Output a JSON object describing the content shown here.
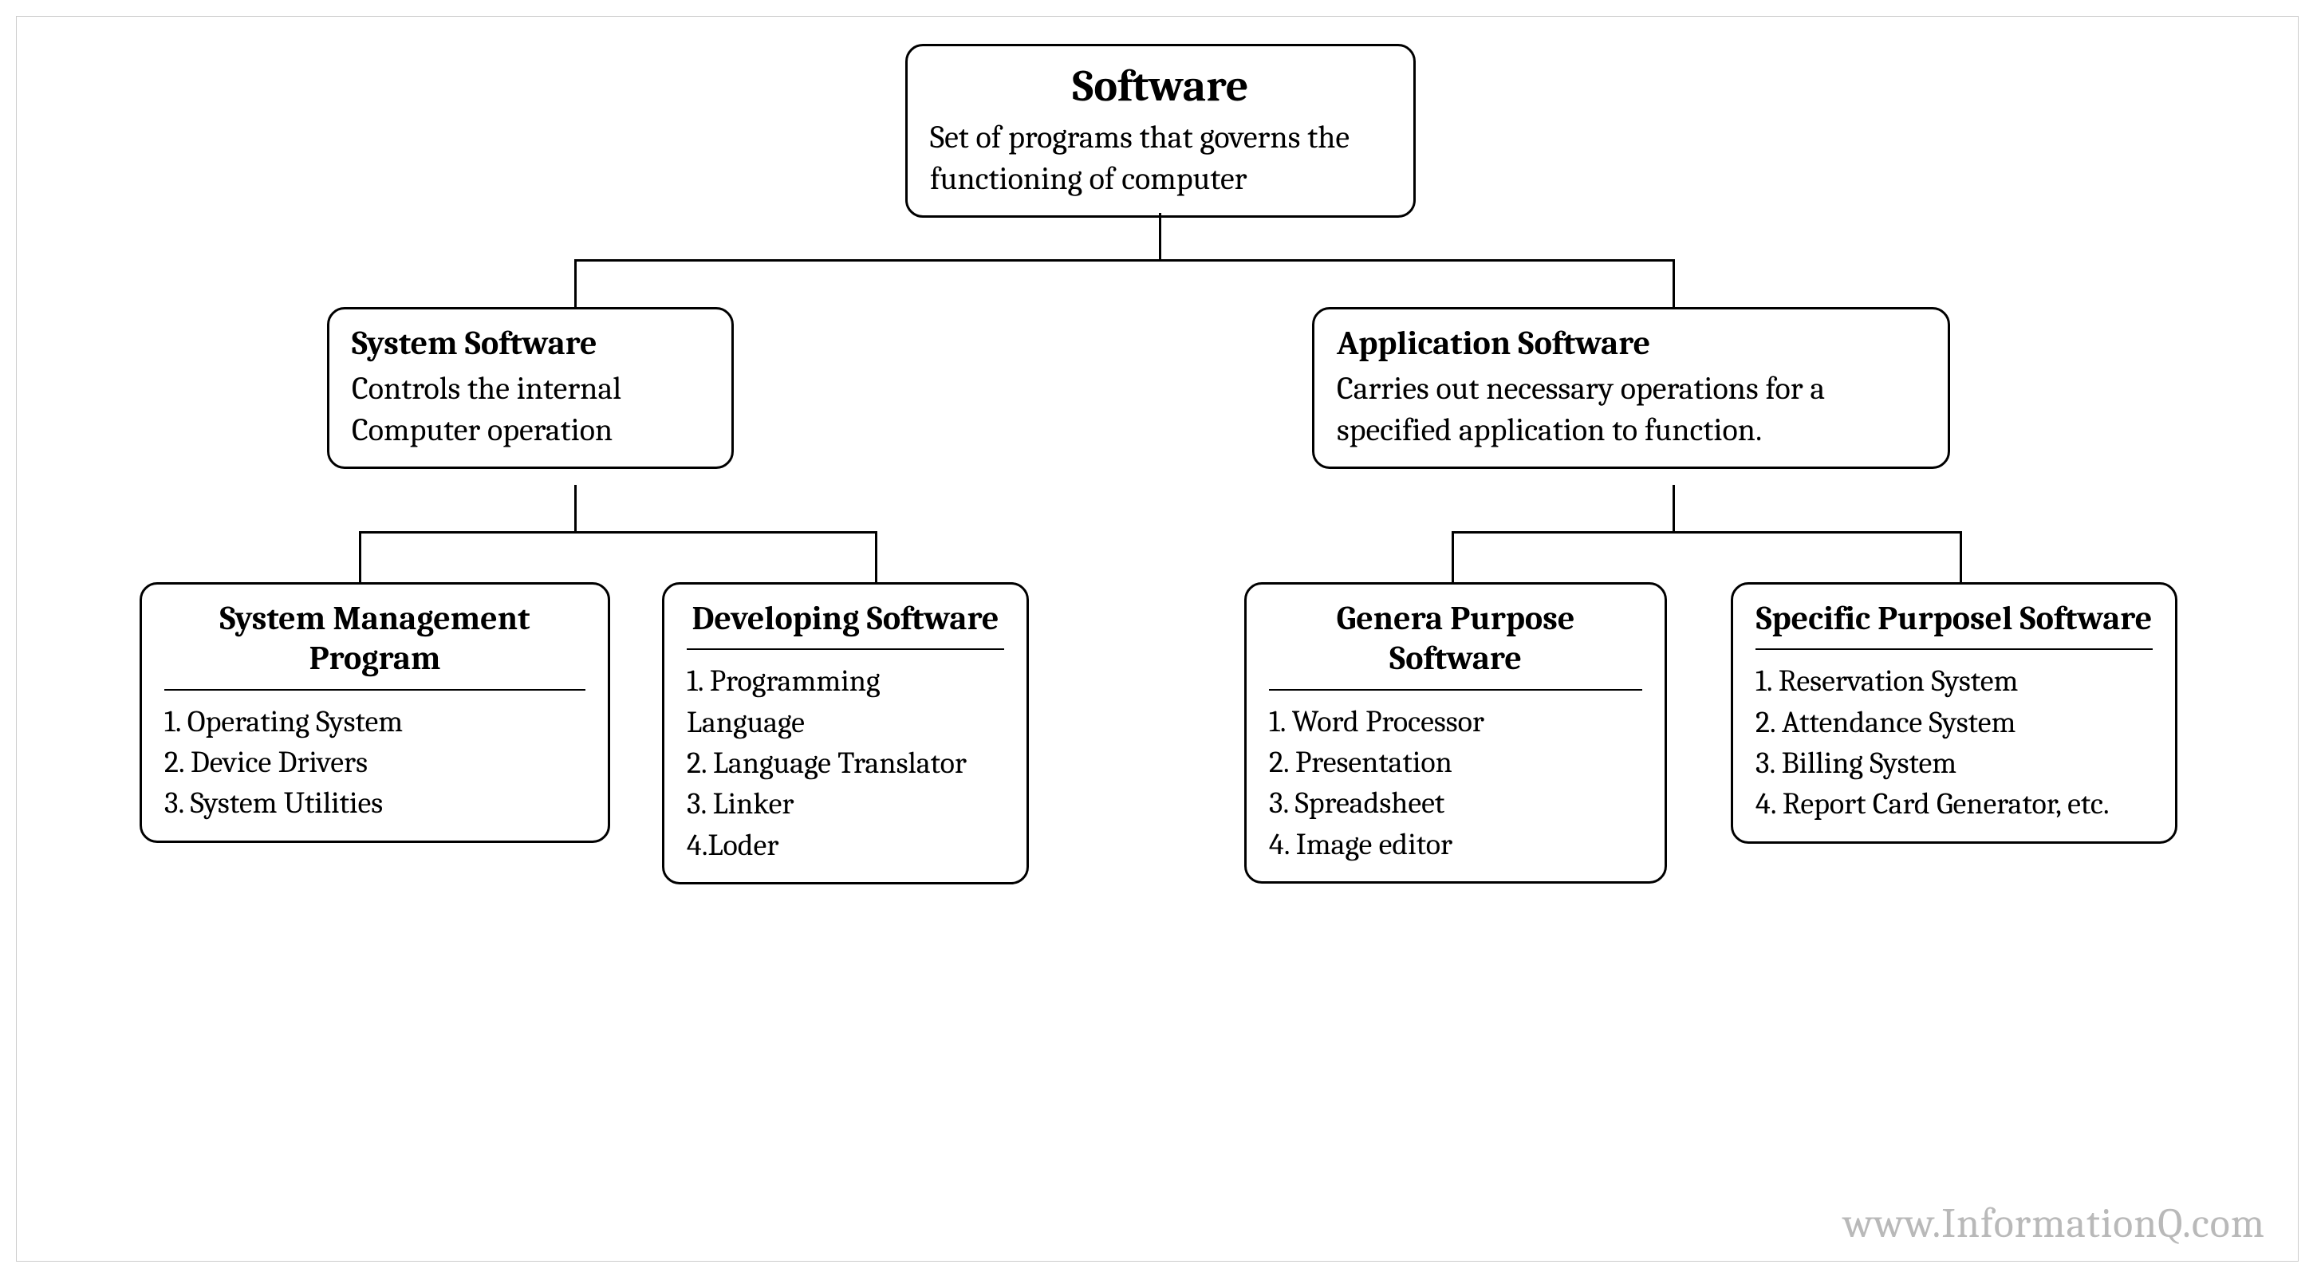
{
  "root": {
    "title": "Software",
    "desc": "Set of programs that governs the  functioning of computer"
  },
  "level1": {
    "system": {
      "title": "System Software",
      "desc": "Controls the internal Computer operation"
    },
    "application": {
      "title": "Application Software",
      "desc": "Carries out necessary operations for a specified application to function."
    }
  },
  "leaves": {
    "sys_mgmt": {
      "title": "System Management Program",
      "items": [
        "1. Operating System",
        "2. Device Drivers",
        "3. System Utilities"
      ]
    },
    "dev_sw": {
      "title": "Developing Software",
      "items": [
        "1. Programming Language",
        "2. Language Translator",
        "3. Linker",
        "4.Loder"
      ]
    },
    "gen_purpose": {
      "title": "Genera Purpose Software",
      "items": [
        "1. Word Processor",
        "2. Presentation",
        "3. Spreadsheet",
        "4. Image editor"
      ]
    },
    "spec_purpose": {
      "title": "Specific Purposel Software",
      "items": [
        "1. Reservation System",
        "2. Attendance System",
        "3. Billing System",
        "4. Report Card Generator, etc."
      ]
    }
  },
  "watermark": "www.InformationQ.com"
}
